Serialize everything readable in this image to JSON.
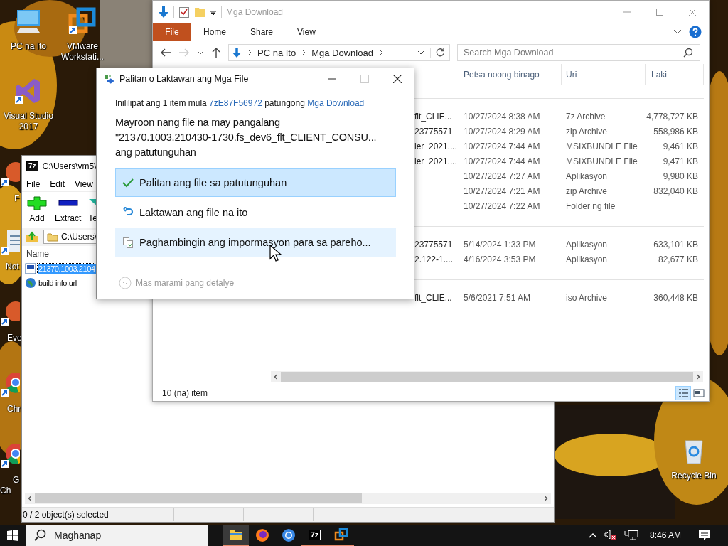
{
  "desktop": {
    "icons": [
      {
        "kind": "pc",
        "label": "PC na Ito"
      },
      {
        "kind": "vmware",
        "label": "VMware Workstati..."
      },
      {
        "kind": "visual-studio",
        "label": "Visual Studio 2017"
      },
      {
        "kind": "app",
        "label": "F"
      },
      {
        "kind": "notepad",
        "label": "Not"
      },
      {
        "kind": "app",
        "label": "Eve"
      },
      {
        "kind": "chrome",
        "label": "Chr"
      },
      {
        "kind": "chrome",
        "label": "G\nCh"
      },
      {
        "kind": "recycle-bin",
        "label": "Recycle Bin"
      }
    ]
  },
  "sevenzip": {
    "logo_text": "7z",
    "title": "C:\\Users\\vm5\\",
    "menu": [
      "File",
      "Edit",
      "View"
    ],
    "toolbar": [
      {
        "kind": "add",
        "label": "Add"
      },
      {
        "kind": "extract",
        "label": "Extract"
      },
      {
        "kind": "test",
        "label": "Te"
      }
    ],
    "address": "C:\\Users\\",
    "column": "Name",
    "rows": [
      {
        "kind": "iso",
        "name": "21370.1003.2104",
        "selected": true
      },
      {
        "kind": "url",
        "name": "build info.url",
        "selected": false
      }
    ],
    "status": "0 / 2 object(s) selected"
  },
  "explorer": {
    "title": "Mga Download",
    "ribbon_tabs": [
      {
        "kind": "file",
        "label": "File"
      },
      {
        "kind": "tab",
        "label": "Home"
      },
      {
        "kind": "tab",
        "label": "Share"
      },
      {
        "kind": "tab",
        "label": "View"
      }
    ],
    "address": [
      "PC na Ito",
      "Mga Download"
    ],
    "search": {
      "placeholder": "Search Mga Download"
    },
    "columns": [
      "Petsa noong binago",
      "Uri",
      "Laki"
    ],
    "groups": [
      {
        "rows": [
          {
            "name": "flt_CLIE...",
            "modified": "10/27/2024 8:38 AM",
            "type": "7z Archive",
            "size": "4,778,727 KB"
          },
          {
            "name": "23775571",
            "modified": "10/27/2024 8:29 AM",
            "type": "zip Archive",
            "size": "558,986 KB"
          },
          {
            "name": "ler_2021....",
            "modified": "10/27/2024 7:44 AM",
            "type": "MSIXBUNDLE File",
            "size": "9,461 KB"
          },
          {
            "name": "ler_2021....",
            "modified": "10/27/2024 7:44 AM",
            "type": "MSIXBUNDLE File",
            "size": "9,471 KB"
          },
          {
            "modified": "10/27/2024 7:27 AM",
            "type": "Aplikasyon",
            "size": "9,980 KB"
          },
          {
            "modified": "10/27/2024 7:21 AM",
            "type": "zip Archive",
            "size": "832,040 KB"
          },
          {
            "modified": "10/27/2024 7:22 AM",
            "type": "Folder ng file"
          }
        ]
      },
      {
        "rows": [
          {
            "name": "23775571",
            "modified": "5/14/2024 1:33 PM",
            "type": "Aplikasyon",
            "size": "633,101 KB"
          },
          {
            "name": "2.122-1....",
            "modified": "4/16/2024 3:53 PM",
            "type": "Aplikasyon",
            "size": "82,677 KB"
          }
        ]
      },
      {
        "rows": [
          {
            "name": "flt_CLIE...",
            "modified": "5/6/2021 7:51 AM",
            "type": "iso Archive",
            "size": "360,448 KB"
          }
        ]
      }
    ],
    "status": "10 (na) item",
    "view_modes": [
      {
        "kind": "details",
        "selected": true
      },
      {
        "kind": "large-icons",
        "selected": false
      }
    ]
  },
  "dialog": {
    "title": "Palitan o Laktawan ang Mga File",
    "info": [
      {
        "kind": "text",
        "text": "Inililipat ang 1 item mula "
      },
      {
        "kind": "link",
        "text": "7zE87F56972"
      },
      {
        "kind": "text",
        "text": " patungong "
      },
      {
        "kind": "link",
        "text": "Mga Download"
      }
    ],
    "message": "Mayroon nang file na may pangalang\n\"21370.1003.210430-1730.fs_dev6_flt_CLIENT_CONSU...\nang patutunguhan",
    "options": [
      {
        "kind": "replace",
        "label": "Palitan ang file sa patutunguhan",
        "selected": true,
        "hovered": false
      },
      {
        "kind": "skip",
        "label": "Laktawan ang file na ito",
        "selected": false,
        "hovered": false
      },
      {
        "kind": "compare",
        "label": "Paghambingin ang impormasyon para sa pareho...",
        "selected": false,
        "hovered": true
      }
    ],
    "details": "Mas marami pang detalye"
  },
  "taskbar": {
    "search": {
      "placeholder": "Maghanap"
    },
    "apps": [
      {
        "kind": "explorer",
        "active": true,
        "running": true
      },
      {
        "kind": "firefox",
        "active": false,
        "running": false
      },
      {
        "kind": "chrome",
        "active": false,
        "running": false
      },
      {
        "kind": "sevenzip",
        "text": "7z",
        "active": false,
        "running": true
      },
      {
        "kind": "vmware",
        "active": false,
        "running": true
      }
    ],
    "time": "8:46 AM"
  }
}
